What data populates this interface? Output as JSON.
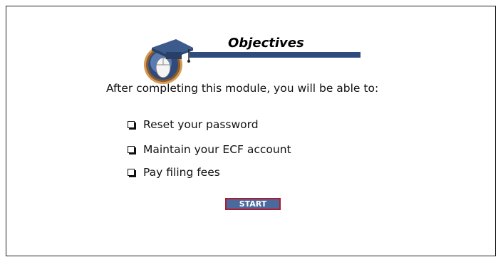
{
  "slide": {
    "title": "Objectives",
    "intro": "After completing this module, you will be able to:",
    "objectives": [
      "Reset your password",
      "Maintain your ECF account",
      "Pay filing fees"
    ],
    "start_label": "START"
  },
  "colors": {
    "title_bar": "#2f4a7c",
    "button_bg": "#4a6a9e",
    "button_border": "#b01c2e"
  },
  "icons": {
    "logo": "graduation-cap-mouse-icon",
    "bullet": "checkbox-icon"
  }
}
